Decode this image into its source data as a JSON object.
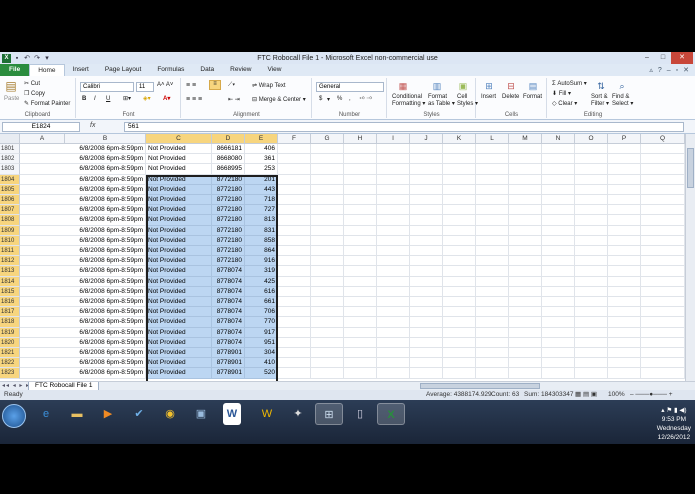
{
  "window": {
    "title": "FTC Robocall File 1  -  Microsoft Excel non-commercial use"
  },
  "ribbon": {
    "tabs": [
      "File",
      "Home",
      "Insert",
      "Page Layout",
      "Formulas",
      "Data",
      "Review",
      "View"
    ],
    "active_tab": "Home",
    "clipboard": {
      "paste": "Paste",
      "cut": "Cut",
      "copy": "Copy",
      "format_painter": "Format Painter",
      "label": "Clipboard"
    },
    "font": {
      "name": "Calibri",
      "size": "11",
      "bold": "B",
      "italic": "I",
      "underline": "U",
      "label": "Font"
    },
    "alignment": {
      "wrap_text": "Wrap Text",
      "merge": "Merge & Center",
      "label": "Alignment"
    },
    "number": {
      "format": "General",
      "currency": "$",
      "percent": "%",
      "comma": ",",
      "label": "Number"
    },
    "styles": {
      "conditional": [
        "Conditional",
        "Formatting"
      ],
      "format_table": [
        "Format",
        "as Table"
      ],
      "cell_styles": [
        "Cell",
        "Styles"
      ],
      "label": "Styles"
    },
    "cells": {
      "insert": "Insert",
      "delete": "Delete",
      "format": "Format",
      "label": "Cells"
    },
    "editing": {
      "autosum": "AutoSum",
      "fill": "Fill",
      "clear": "Clear",
      "sort": [
        "Sort &",
        "Filter"
      ],
      "find": [
        "Find &",
        "Select"
      ],
      "label": "Editing"
    }
  },
  "formula_bar": {
    "name_box": "E1824",
    "fx": "fx",
    "value": "561"
  },
  "grid": {
    "columns": [
      "A",
      "B",
      "C",
      "D",
      "E",
      "F",
      "G",
      "H",
      "I",
      "J",
      "K",
      "L",
      "M",
      "N",
      "O",
      "P",
      "Q"
    ],
    "selected_columns": [
      "C",
      "D",
      "E"
    ],
    "rows": [
      {
        "n": "1801",
        "a": "6/8/2008 6pm-8:59pm",
        "c": "Not Provided",
        "d": "8666181",
        "e": "406"
      },
      {
        "n": "1802",
        "a": "6/8/2008 6pm-8:59pm",
        "c": "Not Provided",
        "d": "8668080",
        "e": "361"
      },
      {
        "n": "1803",
        "a": "6/8/2008 6pm-8:59pm",
        "c": "Not Provided",
        "d": "8668995",
        "e": "253"
      },
      {
        "n": "1804",
        "a": "6/8/2008 6pm-8:59pm",
        "c": "Not Provided",
        "d": "8772180",
        "e": "201"
      },
      {
        "n": "1805",
        "a": "6/8/2008 6pm-8:59pm",
        "c": "Not Provided",
        "d": "8772180",
        "e": "443"
      },
      {
        "n": "1806",
        "a": "6/8/2008 6pm-8:59pm",
        "c": "Not Provided",
        "d": "8772180",
        "e": "718"
      },
      {
        "n": "1807",
        "a": "6/8/2008 6pm-8:59pm",
        "c": "Not Provided",
        "d": "8772180",
        "e": "727"
      },
      {
        "n": "1808",
        "a": "6/8/2008 6pm-8:59pm",
        "c": "Not Provided",
        "d": "8772180",
        "e": "813"
      },
      {
        "n": "1809",
        "a": "6/8/2008 6pm-8:59pm",
        "c": "Not Provided",
        "d": "8772180",
        "e": "831"
      },
      {
        "n": "1810",
        "a": "6/8/2008 6pm-8:59pm",
        "c": "Not Provided",
        "d": "8772180",
        "e": "858"
      },
      {
        "n": "1811",
        "a": "6/8/2008 6pm-8:59pm",
        "c": "Not Provided",
        "d": "8772180",
        "e": "864"
      },
      {
        "n": "1812",
        "a": "6/8/2008 6pm-8:59pm",
        "c": "Not Provided",
        "d": "8772180",
        "e": "916"
      },
      {
        "n": "1813",
        "a": "6/8/2008 6pm-8:59pm",
        "c": "Not Provided",
        "d": "8778074",
        "e": "319"
      },
      {
        "n": "1814",
        "a": "6/8/2008 6pm-8:59pm",
        "c": "Not Provided",
        "d": "8778074",
        "e": "425"
      },
      {
        "n": "1815",
        "a": "6/8/2008 6pm-8:59pm",
        "c": "Not Provided",
        "d": "8778074",
        "e": "616"
      },
      {
        "n": "1816",
        "a": "6/8/2008 6pm-8:59pm",
        "c": "Not Provided",
        "d": "8778074",
        "e": "661"
      },
      {
        "n": "1817",
        "a": "6/8/2008 6pm-8:59pm",
        "c": "Not Provided",
        "d": "8778074",
        "e": "706"
      },
      {
        "n": "1818",
        "a": "6/8/2008 6pm-8:59pm",
        "c": "Not Provided",
        "d": "8778074",
        "e": "770"
      },
      {
        "n": "1819",
        "a": "6/8/2008 6pm-8:59pm",
        "c": "Not Provided",
        "d": "8778074",
        "e": "917"
      },
      {
        "n": "1820",
        "a": "6/8/2008 6pm-8:59pm",
        "c": "Not Provided",
        "d": "8778074",
        "e": "951"
      },
      {
        "n": "1821",
        "a": "6/8/2008 6pm-8:59pm",
        "c": "Not Provided",
        "d": "8778901",
        "e": "304"
      },
      {
        "n": "1822",
        "a": "6/8/2008 6pm-8:59pm",
        "c": "Not Provided",
        "d": "8778901",
        "e": "410"
      },
      {
        "n": "1823",
        "a": "6/8/2008 6pm-8:59pm",
        "c": "Not Provided",
        "d": "8778901",
        "e": "520"
      }
    ],
    "selection_start_row": "1804"
  },
  "sheet_tab": "FTC Robocall File 1",
  "status_bar": {
    "mode": "Ready",
    "average": "Average: 4388174.929",
    "count": "Count: 63",
    "sum": "Sum: 184303347",
    "zoom": "100%"
  },
  "taskbar": {
    "time": "9:53 PM",
    "day": "Wednesday",
    "date": "12/26/2012"
  },
  "colors": {
    "file_tab": "#2a8c3e",
    "selection": "#bcd6f2",
    "header_highlight": "#f7d57e"
  }
}
